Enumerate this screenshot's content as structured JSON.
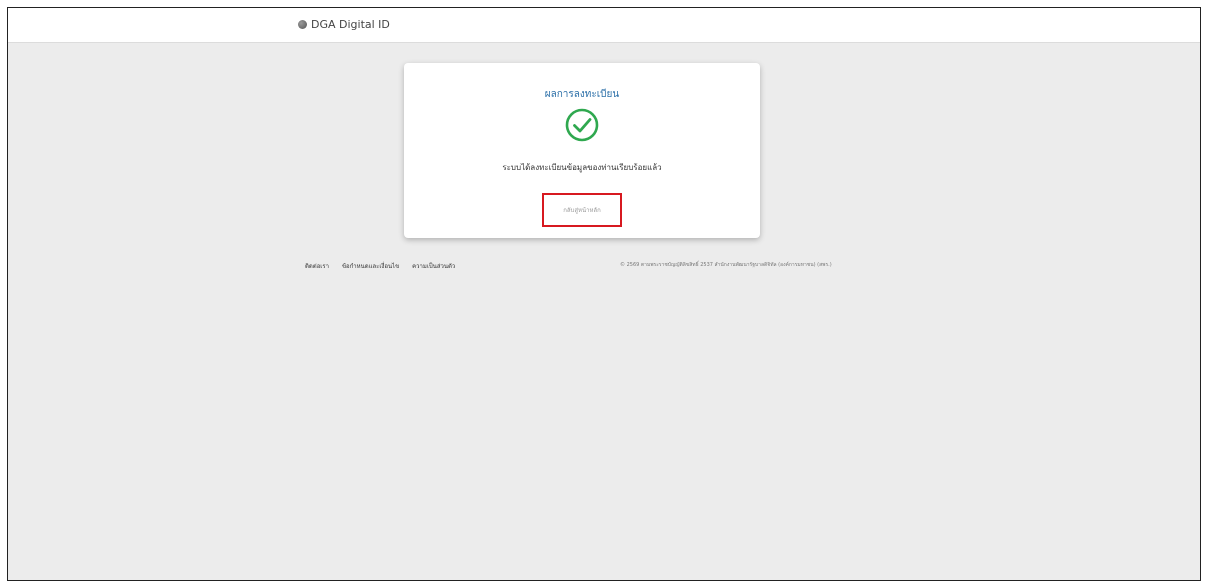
{
  "header": {
    "brand_label": "DGA Digital ID",
    "brand_icon": "globe-icon"
  },
  "result_card": {
    "title": "ผลการลงทะเบียน",
    "status_icon": "check-circle-icon",
    "message": "ระบบได้ลงทะเบียนข้อมูลของท่านเรียบร้อยแล้ว",
    "back_button_label": "กลับสู่หน้าหลัก"
  },
  "footer": {
    "links": [
      "ติดต่อเรา",
      "ข้อกำหนดและเงื่อนไข",
      "ความเป็นส่วนตัว"
    ],
    "copyright": "© 2569 ตามพระราชบัญญัติลิขสิทธิ์ 2537 สำนักงานพัฒนารัฐบาลดิจิทัล (องค์การมหาชน) (สพร.)"
  },
  "colors": {
    "accent": "#2b6fa8",
    "success": "#2fa84f",
    "highlight_border": "#d71920",
    "background": "#ececec"
  }
}
